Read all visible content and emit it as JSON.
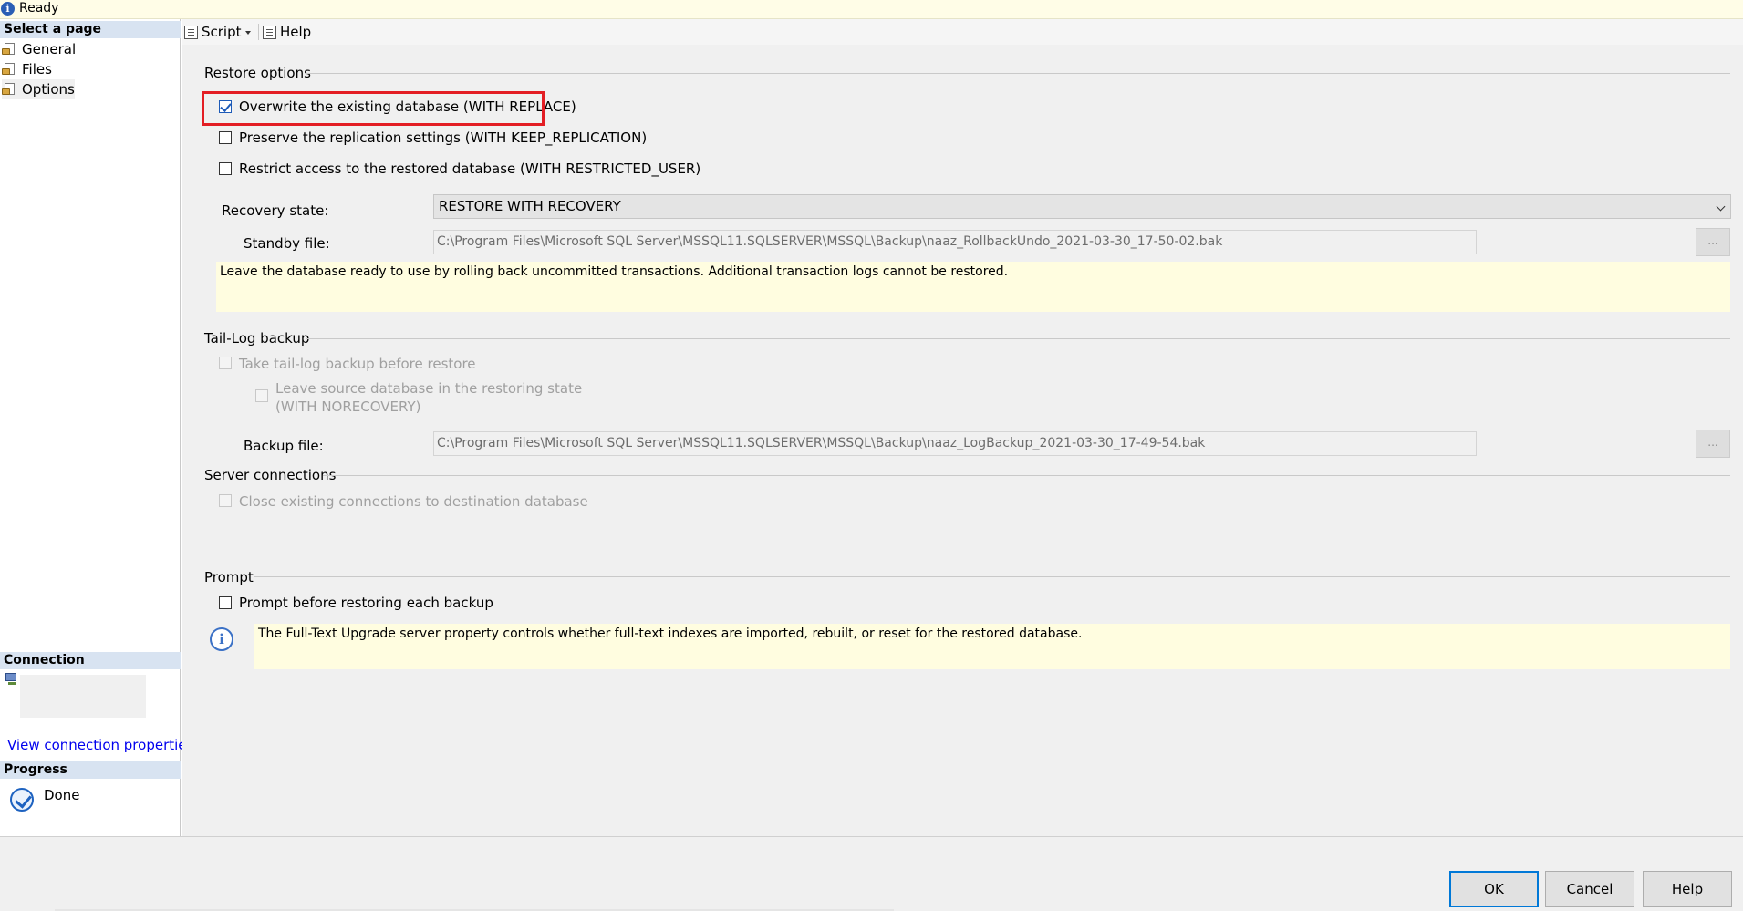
{
  "status": {
    "text": "Ready",
    "icon": "info-icon"
  },
  "sidebar": {
    "select_heading": "Select a page",
    "pages": [
      {
        "label": "General",
        "icon": "page-settings-icon",
        "active": false
      },
      {
        "label": "Files",
        "icon": "page-settings-icon",
        "active": false
      },
      {
        "label": "Options",
        "icon": "page-settings-icon",
        "active": true
      }
    ],
    "connection_heading": "Connection",
    "connection_link": "View connection properties",
    "progress_heading": "Progress",
    "progress_status": "Done"
  },
  "toolbar": {
    "script_label": "Script",
    "help_label": "Help"
  },
  "restore_options": {
    "heading": "Restore options",
    "overwrite": {
      "label": "Overwrite the existing database (WITH REPLACE)",
      "checked": true
    },
    "preserve": {
      "label": "Preserve the replication settings (WITH KEEP_REPLICATION)",
      "checked": false
    },
    "restrict": {
      "label": "Restrict access to the restored database (WITH RESTRICTED_USER)",
      "checked": false
    },
    "recovery_label": "Recovery state:",
    "recovery_value": "RESTORE WITH RECOVERY",
    "standby_label": "Standby file:",
    "standby_value": "C:\\Program Files\\Microsoft SQL Server\\MSSQL11.SQLSERVER\\MSSQL\\Backup\\naaz_RollbackUndo_2021-03-30_17-50-02.bak",
    "browse_label": "...",
    "description": "Leave the database ready to use by rolling back uncommitted transactions. Additional transaction logs cannot be restored."
  },
  "tail_log": {
    "heading": "Tail-Log backup",
    "take_backup": "Take tail-log backup before restore",
    "leave_source_line1": "Leave source database in the restoring state",
    "leave_source_line2": "(WITH NORECOVERY)",
    "backup_file_label": "Backup file:",
    "backup_file_value": "C:\\Program Files\\Microsoft SQL Server\\MSSQL11.SQLSERVER\\MSSQL\\Backup\\naaz_LogBackup_2021-03-30_17-49-54.bak",
    "browse_label": "..."
  },
  "server_connections": {
    "heading": "Server connections",
    "close_existing": "Close existing connections to destination database"
  },
  "prompt": {
    "heading": "Prompt",
    "prompt_each": "Prompt before restoring each backup",
    "info_text": "The Full-Text Upgrade server property controls whether full-text indexes are imported, rebuilt, or reset for the restored database."
  },
  "buttons": {
    "ok": "OK",
    "cancel": "Cancel",
    "help": "Help"
  },
  "colors": {
    "highlight": "#e31e24",
    "note_bg": "#fffde0",
    "link": "#0000ee",
    "accent": "#0078d7"
  }
}
